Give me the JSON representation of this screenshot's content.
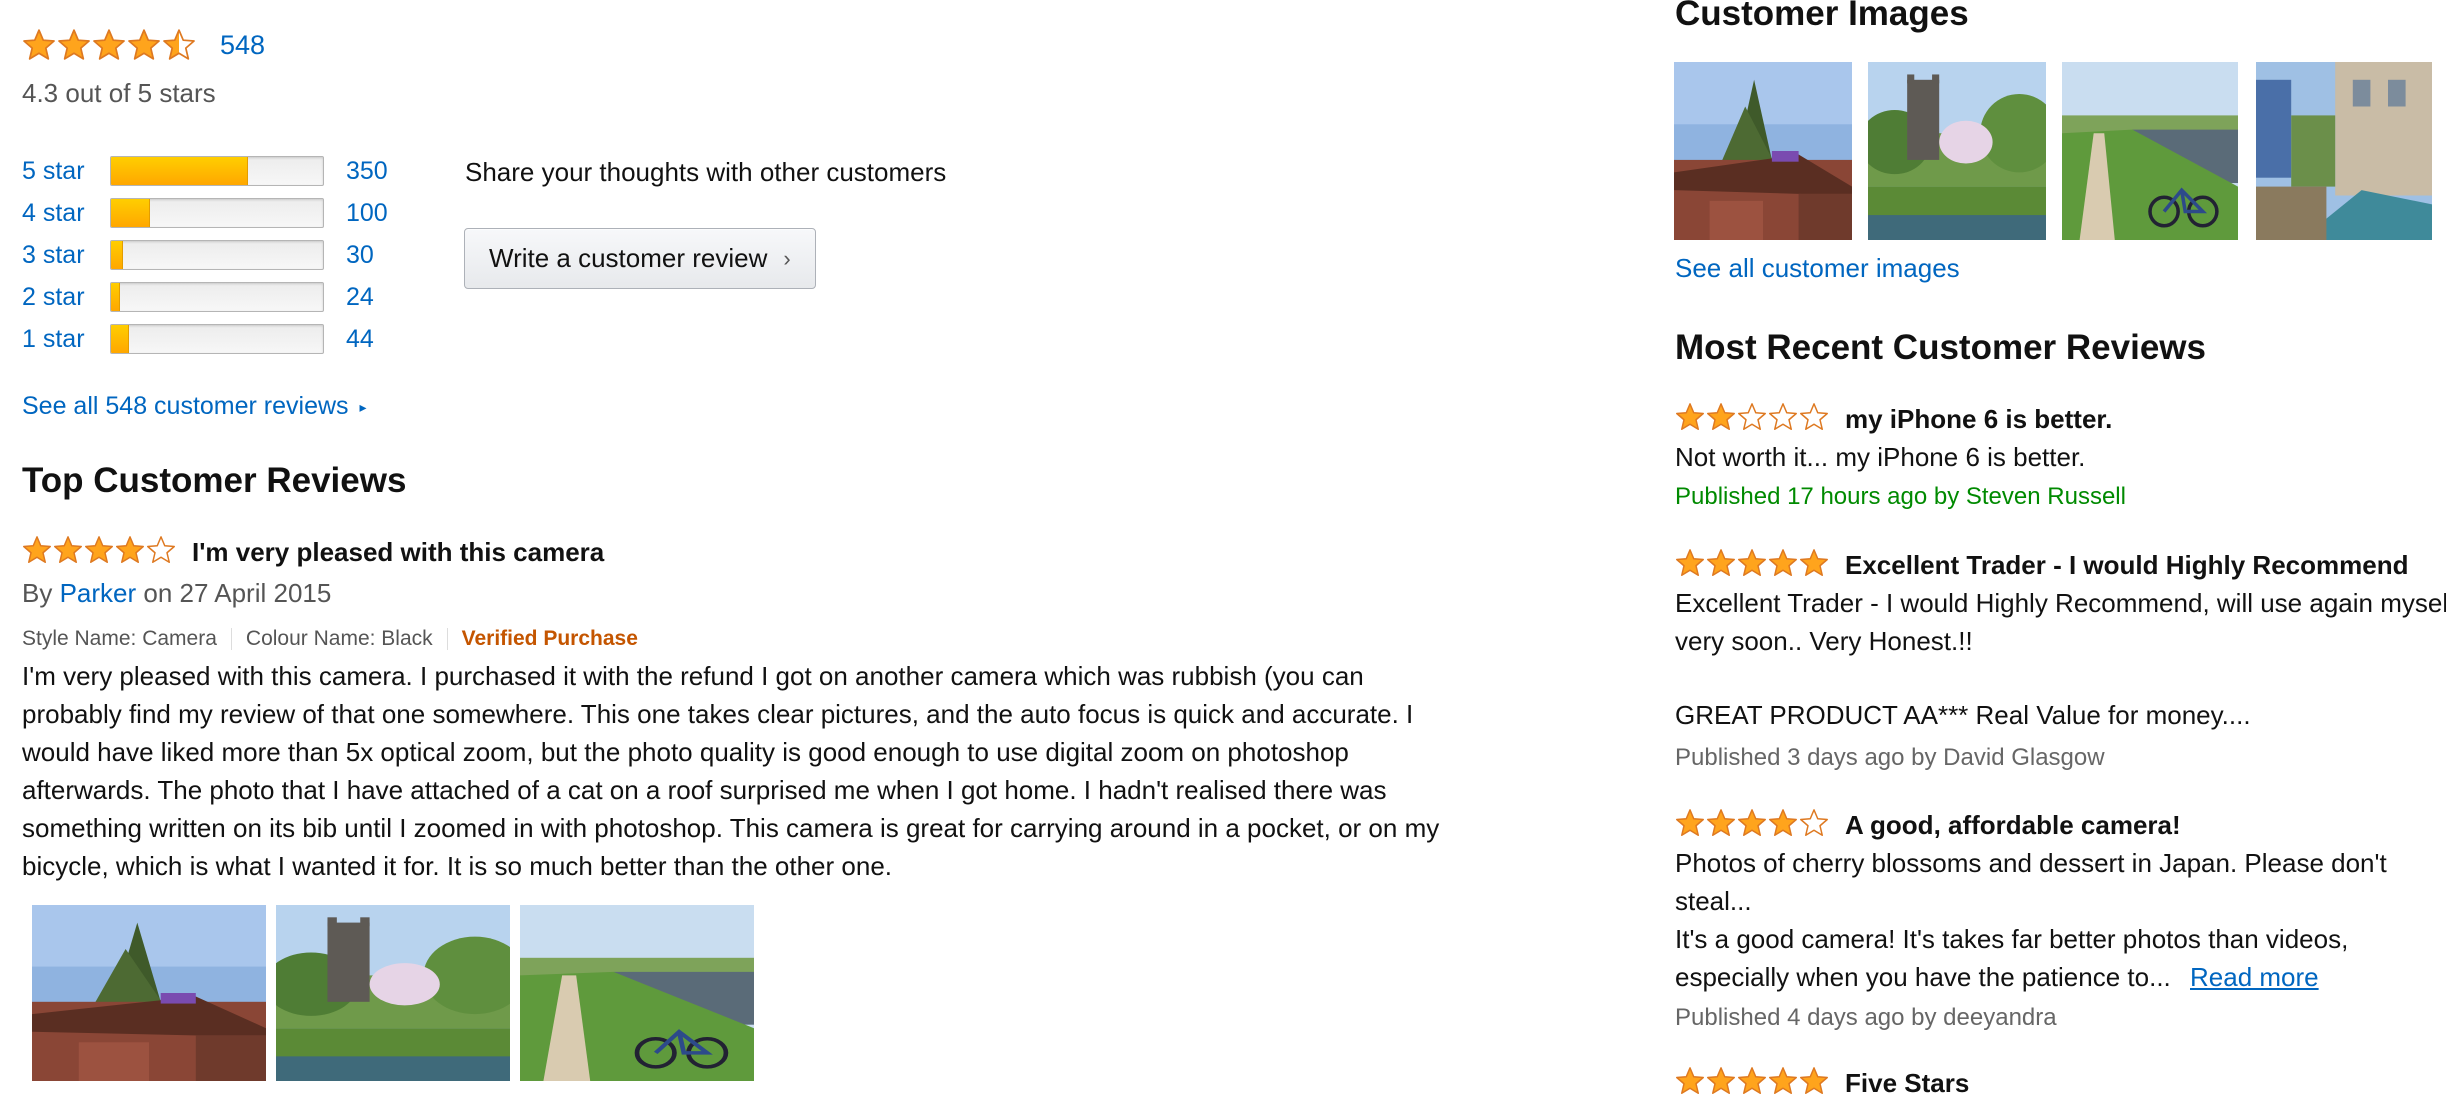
{
  "summary": {
    "rating": 4.3,
    "rating_count": "548",
    "rating_text": "4.3 out of 5 stars"
  },
  "histogram": [
    {
      "label": "5 star",
      "count": "350",
      "percent": 64
    },
    {
      "label": "4 star",
      "count": "100",
      "percent": 18
    },
    {
      "label": "3 star",
      "count": "30",
      "percent": 5
    },
    {
      "label": "2 star",
      "count": "24",
      "percent": 4
    },
    {
      "label": "1 star",
      "count": "44",
      "percent": 8
    }
  ],
  "share": {
    "prompt": "Share your thoughts with other customers",
    "button_label": "Write a customer review"
  },
  "see_all_reviews": "See all 548 customer reviews",
  "top_reviews": {
    "heading": "Top Customer Reviews",
    "review": {
      "rating": 4,
      "title": "I'm very pleased with this camera",
      "by_prefix": "By",
      "author": "Parker",
      "date": "on 27 April 2015",
      "style": "Style Name: Camera",
      "colour": "Colour Name: Black",
      "verified": "Verified Purchase",
      "lines": [
        "I'm very pleased with this camera. I purchased it with the refund I got on another camera which was rubbish (you can",
        "probably find my review of that one somewhere. This one takes clear pictures, and the auto focus is quick and accurate. I",
        "would have liked more than 5x optical zoom, but the photo quality is good enough to use digital zoom on photoshop",
        "afterwards. The photo that I have attached of a cat on a roof surprised me when I got home. I hadn't realised there was",
        "something written on its bib until I zoomed in with photoshop. This camera is great for carrying around in a pocket, or on my",
        "bicycle, which is what I wanted it for. It is so much better than the other one."
      ],
      "images": [
        "shed-photo",
        "church-photo",
        "river-bicycle-photo"
      ]
    }
  },
  "customer_images": {
    "heading": "Customer Images",
    "images": [
      "shed-photo",
      "church-photo",
      "river-bicycle-photo",
      "garden-building-photo"
    ],
    "see_all": "See all customer images"
  },
  "recent_reviews": {
    "heading": "Most Recent Customer Reviews",
    "items": [
      {
        "rating": 2,
        "title": "my iPhone 6 is better.",
        "lines": [
          "Not worth it... my iPhone 6 is better."
        ],
        "published": "Published 17 hours ago by Steven Russell"
      },
      {
        "rating": 5,
        "title": "Excellent Trader - I would Highly Recommend",
        "lines": [
          "Excellent Trader - I would Highly Recommend, will use again myself",
          "very soon.. Very Honest.!!",
          "",
          "GREAT PRODUCT AA*** Real Value for money...."
        ],
        "published": "Published 3 days ago by David Glasgow"
      },
      {
        "rating": 4,
        "title": "A good, affordable camera!",
        "lines": [
          "Photos of cherry blossoms and dessert in Japan. Please don't",
          "steal...",
          "It's a good camera! It's takes far better photos than videos,",
          "especially when you have the patience to..."
        ],
        "read_more": "Read more",
        "published": "Published 4 days ago by deeyandra"
      },
      {
        "rating": 5,
        "title": "Five Stars"
      }
    ]
  },
  "colors": {
    "link": "#0066c0",
    "star": "#ffa41c",
    "star_border": "#de7921",
    "verified": "#c45500",
    "published": "#008a00"
  }
}
